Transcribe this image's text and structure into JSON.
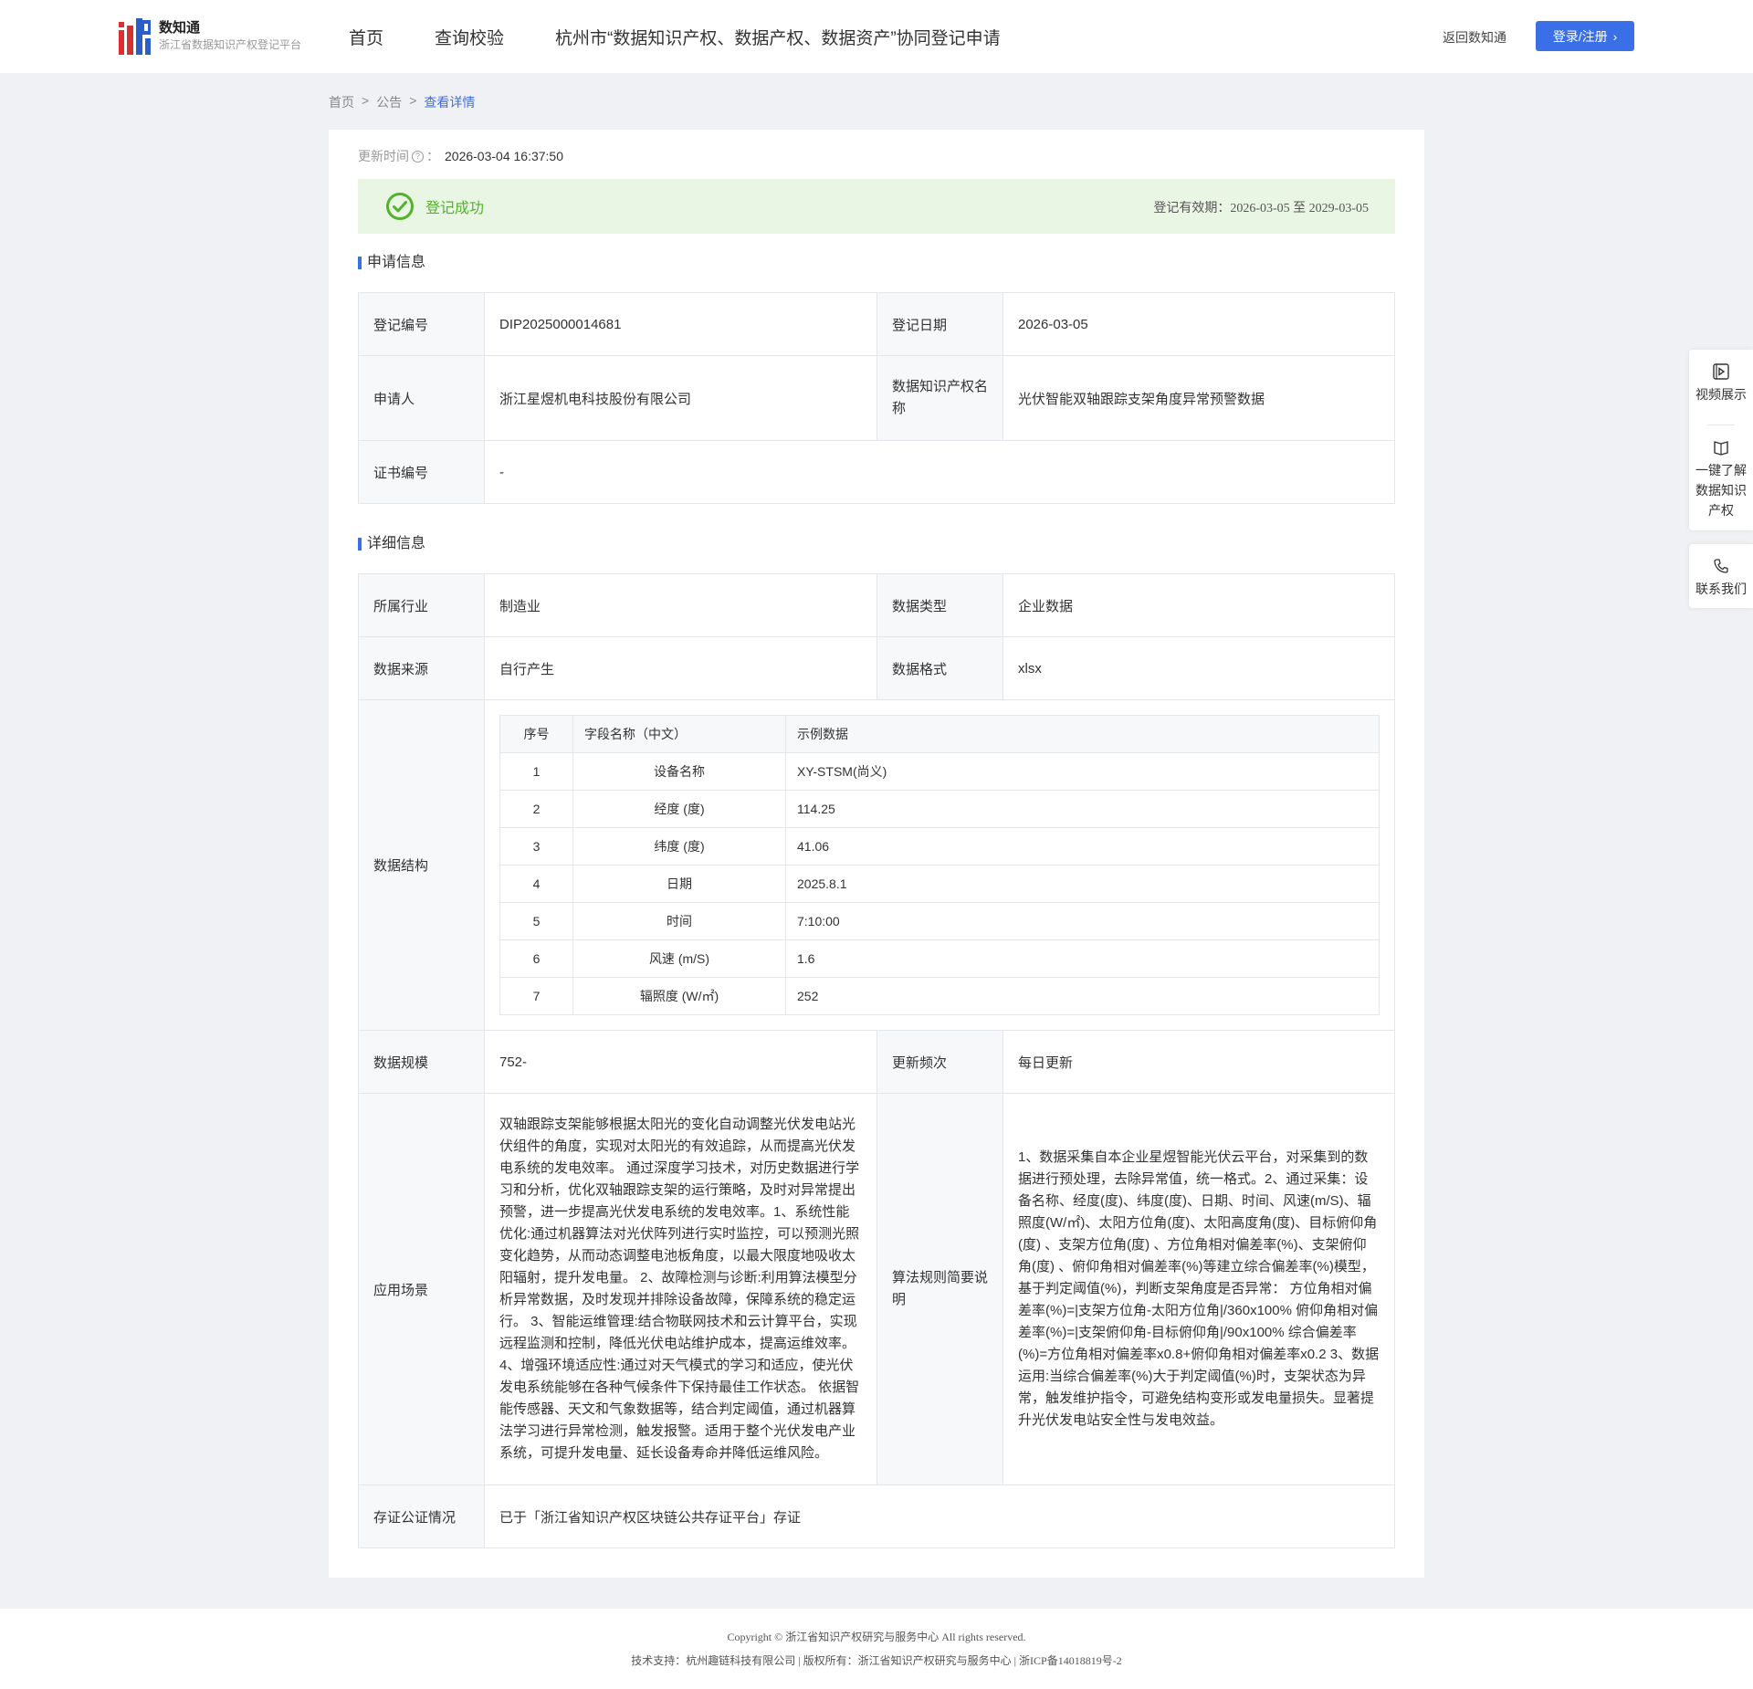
{
  "header": {
    "logo_name": "数知通",
    "logo_sub": "浙江省数据知识产权登记平台",
    "nav": [
      "首页",
      "查询校验",
      "杭州市“数据知识产权、数据产权、数据资产”协同登记申请"
    ],
    "back_link": "返回数知通",
    "login_button": "登录/注册"
  },
  "breadcrumb": [
    "首页",
    "公告",
    "查看详情"
  ],
  "update": {
    "label": "更新时间",
    "value": "2026-03-04 16:37:50"
  },
  "status": {
    "text": "登记成功",
    "validity": "登记有效期：2026-03-05 至 2029-03-05"
  },
  "apply": {
    "title": "申请信息",
    "reg_no_label": "登记编号",
    "reg_no": "DIP2025000014681",
    "reg_date_label": "登记日期",
    "reg_date": "2026-03-05",
    "applicant_label": "申请人",
    "applicant": "浙江星煜机电科技股份有限公司",
    "ip_name_label": "数据知识产权名称",
    "ip_name": "光伏智能双轴跟踪支架角度异常预警数据",
    "cert_label": "证书编号",
    "cert": "-"
  },
  "detail": {
    "title": "详细信息",
    "industry_label": "所属行业",
    "industry": "制造业",
    "type_label": "数据类型",
    "type": "企业数据",
    "source_label": "数据来源",
    "source": "自行产生",
    "format_label": "数据格式",
    "format": "xlsx",
    "structure_label": "数据结构",
    "structure_headers": [
      "序号",
      "字段名称（中文）",
      "示例数据"
    ],
    "structure_rows": [
      [
        "1",
        "设备名称",
        "XY-STSM(尚义)"
      ],
      [
        "2",
        "经度 (度)",
        "114.25"
      ],
      [
        "3",
        "纬度 (度)",
        "41.06"
      ],
      [
        "4",
        "日期",
        "2025.8.1"
      ],
      [
        "5",
        "时间",
        "7:10:00"
      ],
      [
        "6",
        "风速 (m/S)",
        "1.6"
      ],
      [
        "7",
        "辐照度 (W/㎡)",
        "252"
      ]
    ],
    "scale_label": "数据规模",
    "scale": "752-",
    "freq_label": "更新频次",
    "freq": "每日更新",
    "scene_label": "应用场景",
    "scene": "双轴跟踪支架能够根据太阳光的变化自动调整光伏发电站光伏组件的角度，实现对太阳光的有效追踪，从而提高光伏发电系统的发电效率。 通过深度学习技术，对历史数据进行学习和分析，优化双轴跟踪支架的运行策略，及时对异常提出预警，进一步提高光伏发电系统的发电效率。1、系统性能优化:通过机器算法对光伏阵列进行实时监控，可以预测光照变化趋势，从而动态调整电池板角度，以最大限度地吸收太阳辐射，提升发电量。 2、故障检测与诊断:利用算法模型分析异常数据，及时发现并排除设备故障，保障系统的稳定运行。 3、智能运维管理:结合物联网技术和云计算平台，实现远程监测和控制，降低光伏电站维护成本，提高运维效率。 4、增强环境适应性:通过对天气模式的学习和适应，使光伏发电系统能够在各种气候条件下保持最佳工作状态。 依据智能传感器、天文和气象数据等，结合判定阈值，通过机器算法学习进行异常检测，触发报警。适用于整个光伏发电产业系统，可提升发电量、延长设备寿命并降低运维风险。",
    "algo_label": "算法规则简要说明",
    "algo": "1、数据采集自本企业星煜智能光伏云平台，对采集到的数据进行预处理，去除异常值，统一格式。2、通过采集：设备名称、经度(度)、纬度(度)、日期、时间、风速(m/S)、辐照度(W/㎡)、太阳方位角(度)、太阳高度角(度)、目标俯仰角(度) 、支架方位角(度) 、方位角相对偏差率(%)、支架俯仰角(度) 、俯仰角相对偏差率(%)等建立综合偏差率(%)模型，基于判定阈值(%)，判断支架角度是否异常： 方位角相对偏差率(%)=|支架方位角-太阳方位角|/360x100% 俯仰角相对偏差率(%)=|支架俯仰角-目标俯仰角|/90x100% 综合偏差率(%)=方位角相对偏差率x0.8+俯仰角相对偏差率x0.2 3、数据运用:当综合偏差率(%)大于判定阈值(%)时，支架状态为异常，触发维护指令，可避免结构变形或发电量损失。显著提升光伏发电站安全性与发电效益。",
    "notary_label": "存证公证情况",
    "notary": "已于「浙江省知识产权区块链公共存证平台」存证"
  },
  "side": [
    "视频展示",
    "一键了解数据知识产权",
    "联系我们"
  ],
  "footer": {
    "copyright": "Copyright © 浙江省知识产权研究与服务中心 All rights reserved.",
    "support": "技术支持：杭州趣链科技有限公司 | 版权所有：浙江省知识产权研究与服务中心 | 浙ICP备14018819号-2"
  },
  "colors": {
    "accent": "#3b6fe8",
    "success": "#52b22b",
    "success_bg": "#eaf6e4"
  }
}
